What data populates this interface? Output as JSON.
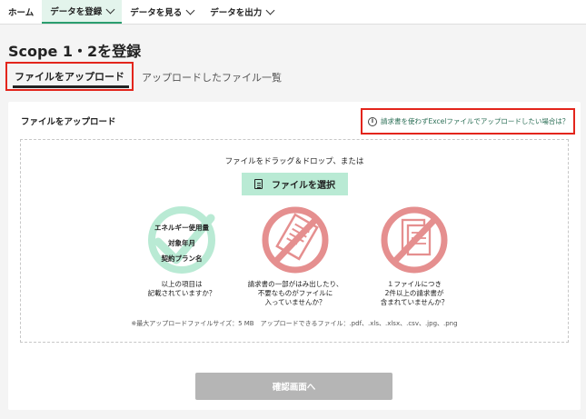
{
  "nav": {
    "items": [
      {
        "label": "ホーム"
      },
      {
        "label": "データを登録"
      },
      {
        "label": "データを見る"
      },
      {
        "label": "データを出力"
      }
    ]
  },
  "page": {
    "title": "Scope 1・2を登録"
  },
  "tabs": [
    {
      "label": "ファイルをアップロード"
    },
    {
      "label": "アップロードしたファイル一覧"
    }
  ],
  "card": {
    "title": "ファイルをアップロード",
    "help_link": "請求書を使わずExcelファイルでアップロードしたい場合は？"
  },
  "dropzone": {
    "prompt": "ファイルをドラッグ＆ドロップ、または",
    "select_button": "ファイルを選択",
    "guides": [
      {
        "labels": [
          "エネルギー使用量",
          "対象年月",
          "契約プラン名"
        ],
        "caption": [
          "以上の項目は",
          "記載されていますか？"
        ]
      },
      {
        "caption": [
          "請求書の一部がはみ出したり、",
          "不要なものがファイルに",
          "入っていませんか？"
        ]
      },
      {
        "caption": [
          "１ファイルにつき",
          "2件以上の請求書が",
          "含まれていませんか？"
        ]
      }
    ],
    "file_note": "※最大アップロードファイルサイズ：5 MB　アップロードできるファイル：.pdf、.xls、.xlsx、.csv、.jpg、.png"
  },
  "confirm_button": "確認画面へ",
  "colors": {
    "accent": "#2a9d6e",
    "highlight_border": "#e3251c",
    "check_green": "#b9ead4",
    "prohibit_red": "#e58f8f",
    "disabled_button": "#b5b5b5"
  }
}
